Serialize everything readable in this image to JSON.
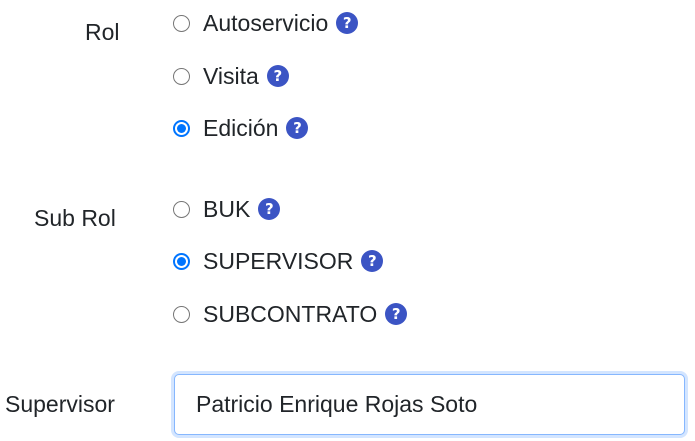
{
  "rol": {
    "label": "Rol",
    "options": [
      {
        "label": "Autoservicio",
        "checked": false
      },
      {
        "label": "Visita",
        "checked": false
      },
      {
        "label": "Edición",
        "checked": true
      }
    ]
  },
  "sub_rol": {
    "label": "Sub Rol",
    "options": [
      {
        "label": "BUK",
        "checked": false
      },
      {
        "label": "SUPERVISOR",
        "checked": true
      },
      {
        "label": "SUBCONTRATO",
        "checked": false
      }
    ]
  },
  "supervisor": {
    "label": "Supervisor",
    "value": "Patricio Enrique Rojas Soto"
  },
  "help_icon_glyph": "?",
  "colors": {
    "accent": "#0075ff",
    "help_icon": "#3b54c4",
    "focus_border": "#86b7fe"
  }
}
